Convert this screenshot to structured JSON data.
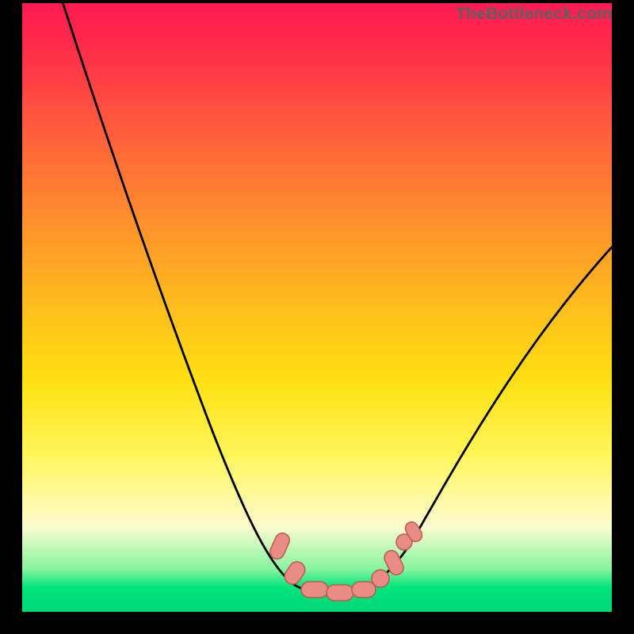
{
  "attribution": "TheBottleneck.com",
  "colors": {
    "frame": "#000000",
    "curve_stroke": "#000000",
    "marker_fill": "#e98c84",
    "marker_stroke": "#bb5a52",
    "gradient_stops": [
      {
        "offset": 0.0,
        "hex": "#ff1a52"
      },
      {
        "offset": 0.08,
        "hex": "#ff2e4a"
      },
      {
        "offset": 0.2,
        "hex": "#ff5a3d"
      },
      {
        "offset": 0.34,
        "hex": "#ff8a2e"
      },
      {
        "offset": 0.48,
        "hex": "#ffb81f"
      },
      {
        "offset": 0.62,
        "hex": "#ffe012"
      },
      {
        "offset": 0.74,
        "hex": "#fff658"
      },
      {
        "offset": 0.86,
        "hex": "#fdfccf"
      },
      {
        "offset": 0.93,
        "hex": "#85f5a0"
      },
      {
        "offset": 0.96,
        "hex": "#00e47a"
      },
      {
        "offset": 1.0,
        "hex": "#00d77a"
      }
    ]
  },
  "chart_data": {
    "type": "line",
    "title": "",
    "xlabel": "",
    "ylabel": "",
    "xlim": [
      0,
      100
    ],
    "ylim": [
      0,
      100
    ],
    "note": "x is horizontal percent across plot, y is vertical percent (0=bottom, 100=top). Curve falls from top-left, reaches a flat valley near y≈4 between x≈42 and x≈60, then rises toward upper right.",
    "series": [
      {
        "name": "bottleneck-curve",
        "x": [
          6,
          10,
          14,
          18,
          22,
          26,
          30,
          34,
          38,
          42,
          46,
          50,
          54,
          58,
          62,
          66,
          70,
          74,
          78,
          82,
          86,
          90,
          94,
          98,
          100
        ],
        "y": [
          100,
          90,
          80,
          70,
          60,
          51,
          42,
          34,
          26,
          18,
          11,
          6,
          4,
          4,
          6,
          10,
          16,
          23,
          30,
          37,
          44,
          51,
          57,
          62,
          65
        ]
      }
    ],
    "markers": {
      "name": "valley-markers",
      "x": [
        44,
        48,
        50,
        52,
        54,
        56,
        58,
        60,
        62
      ],
      "y": [
        12,
        7,
        5,
        4,
        4,
        4,
        5,
        7,
        12
      ]
    }
  }
}
